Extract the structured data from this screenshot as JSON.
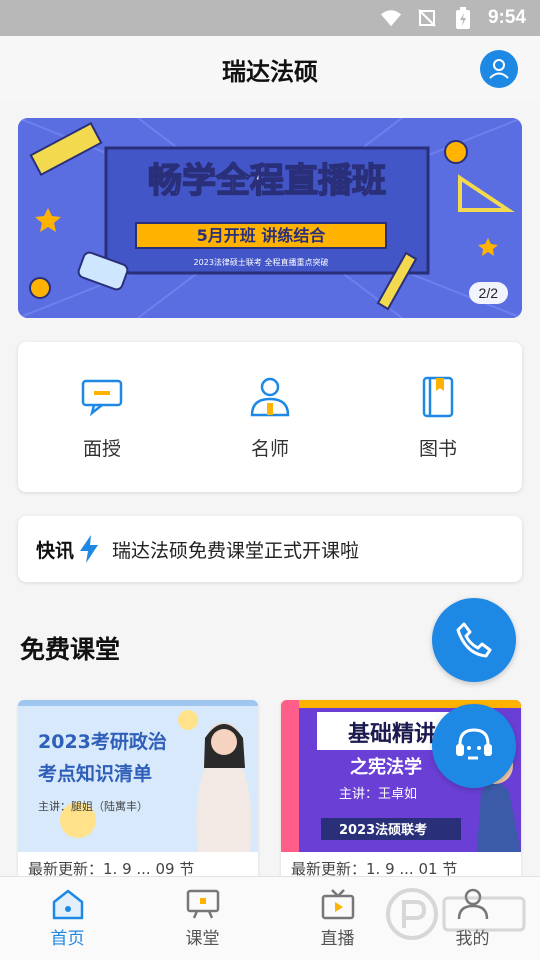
{
  "status_bar": {
    "time": "9:54"
  },
  "header": {
    "title": "瑞达法硕"
  },
  "banner": {
    "headline": "畅学全程直播班",
    "tagline": "5月开班 讲练结合",
    "subline": "2023法律硕士联考 全程直播重点突破",
    "pager": "2/2"
  },
  "quick_menu": [
    {
      "label": "面授",
      "icon": "chat-icon"
    },
    {
      "label": "名师",
      "icon": "teacher-icon"
    },
    {
      "label": "图书",
      "icon": "book-icon"
    }
  ],
  "news": {
    "label": "快讯",
    "text": "瑞达法硕免费课堂正式开课啦"
  },
  "section": {
    "title": "免费课堂"
  },
  "courses": [
    {
      "title_line1": "2023考研政治",
      "title_line2": "考点知识清单",
      "speaker": "主讲：腿姐（陆寓丰）",
      "meta": "最新更新：1. 9 ... 09 节"
    },
    {
      "title_line1": "基础精讲",
      "title_line2": "之宪法学",
      "speaker": "主讲：王卓如",
      "tag": "2023法硕联考",
      "meta": "最新更新：1. 9 ... 01 节"
    }
  ],
  "bottom_nav": [
    {
      "label": "首页",
      "icon": "home-icon",
      "active": true
    },
    {
      "label": "课堂",
      "icon": "classroom-icon",
      "active": false
    },
    {
      "label": "直播",
      "icon": "tv-icon",
      "active": false
    },
    {
      "label": "我的",
      "icon": "user-icon",
      "active": false
    }
  ],
  "colors": {
    "accent": "#1e88e5",
    "banner_bg": "#5b6ee1",
    "banner_tag": "#ffb300"
  }
}
